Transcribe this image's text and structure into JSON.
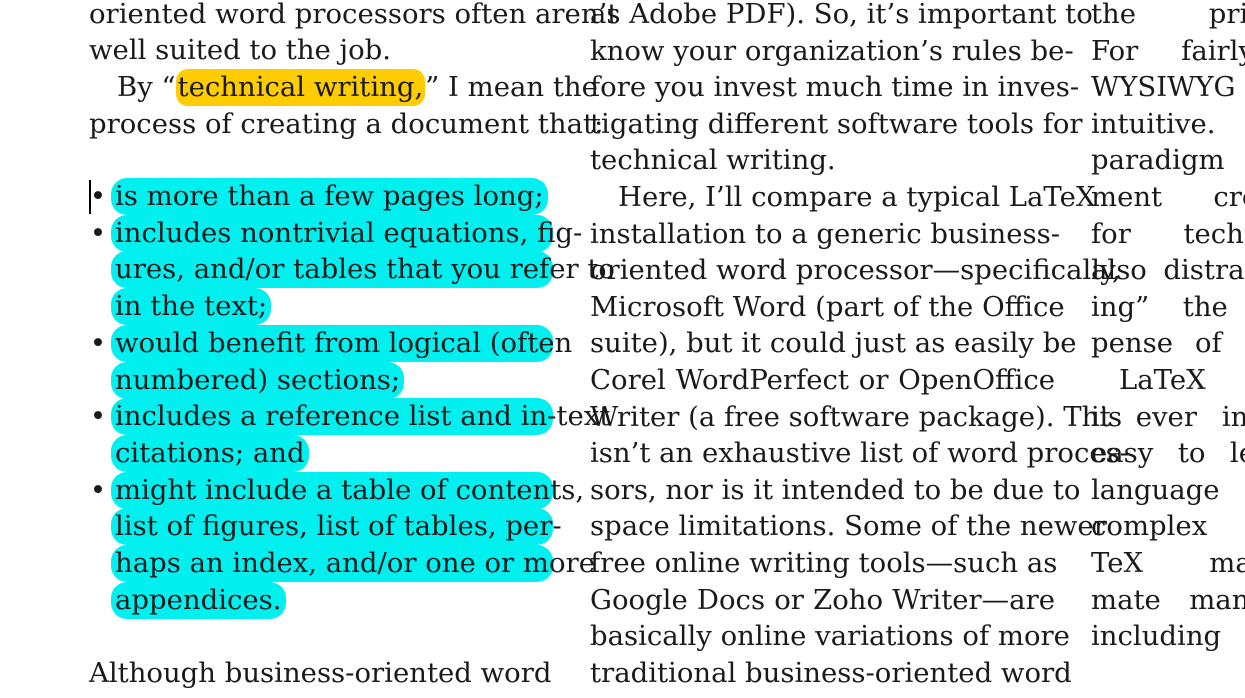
{
  "col1": {
    "lines": [
      "oriented word processors often aren’t",
      "well suited to the job.",
      "By “technical writing,” I mean the",
      "process of creating a document that:",
      "Although business-oriented word"
    ],
    "by_prefix": "By “",
    "by_highlight": "technical writing,",
    "by_suffix": "” I mean the",
    "bullet_char": "•",
    "list_items": [
      [
        "is more than a few pages long;"
      ],
      [
        "includes nontrivial equations, fig-",
        "ures, and/or tables that you refer to",
        "in the text;"
      ],
      [
        "would benefit from logical (often",
        "numbered) sections;"
      ],
      [
        "includes a reference list and in-text",
        "citations; and"
      ],
      [
        "might include a table of contents,",
        "list of figures, list of tables, per-",
        "haps an index, and/or one or more",
        "appendices."
      ]
    ]
  },
  "col2": {
    "lines": [
      "as Adobe PDF). So, it’s important to",
      "know your organization’s rules be-",
      "fore you invest much time in inves-",
      "tigating different software tools for",
      "technical writing.",
      "Here, I’ll compare a typical LaTeX",
      "installation to a generic business-",
      "oriented word processor—specifically,",
      "Microsoft Word (part of the Office",
      "suite), but it could just as easily be",
      "Corel WordPerfect or OpenOffice",
      "Writer (a free software package). This",
      "isn’t an exhaustive list of word proces-",
      "sors, nor is it intended to be due to",
      "space limitations. Some of the newer",
      "free online writing tools—such as",
      "Google Docs or Zoho Writer—are",
      "basically online variations of more",
      "traditional business-oriented word"
    ]
  },
  "col3": {
    "lines": [
      "the printed",
      "For fairly s",
      "WYSIWYG",
      "intuitive. H",
      "paradigm pla",
      "ment creatio",
      "for technical",
      "also distract w",
      "ing” the doc",
      "pense of cond",
      "LaTeX isn",
      "it ever intend",
      "easy to learn,",
      "language fo",
      "complex doc",
      "TeX macros",
      "mate many b",
      "including"
    ]
  },
  "colors": {
    "highlight_yellow": "#ffcc00",
    "highlight_cyan": "#00f0f0",
    "text": "#1a1a1a"
  }
}
